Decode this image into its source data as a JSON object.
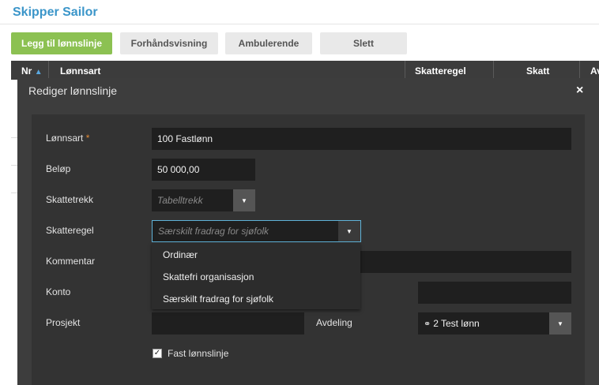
{
  "app": {
    "title": "Skipper Sailor"
  },
  "toolbar": {
    "add_label": "Legg til lønnslinje",
    "preview_label": "Forhåndsvisning",
    "ambulant_label": "Ambulerende",
    "delete_label": "Slett"
  },
  "table": {
    "columns": [
      "Nr",
      "Lønnsart",
      "Skatteregel",
      "Skatt",
      "Av"
    ]
  },
  "dialog": {
    "title": "Rediger lønnslinje",
    "close_icon": "×",
    "fields": {
      "lonnsart": {
        "label": "Lønnsart",
        "required_mark": "*",
        "value": "100 Fastlønn"
      },
      "belop": {
        "label": "Beløp",
        "value": "50 000,00"
      },
      "skattetrekk": {
        "label": "Skattetrekk",
        "placeholder": "Tabelltrekk"
      },
      "skatteregel": {
        "label": "Skatteregel",
        "placeholder": "Særskilt fradrag for sjøfolk"
      },
      "kommentar": {
        "label": "Kommentar"
      },
      "konto": {
        "label": "Konto"
      },
      "prosjekt": {
        "label": "Prosjekt"
      },
      "avdeling": {
        "label": "Avdeling",
        "value": "2 Test lønn"
      },
      "fast": {
        "label": "Fast lønnslinje",
        "checked": true
      }
    },
    "dropdown_options": [
      "Ordinær",
      "Skattefri organisasjon",
      "Særskilt fradrag for sjøfolk"
    ]
  }
}
